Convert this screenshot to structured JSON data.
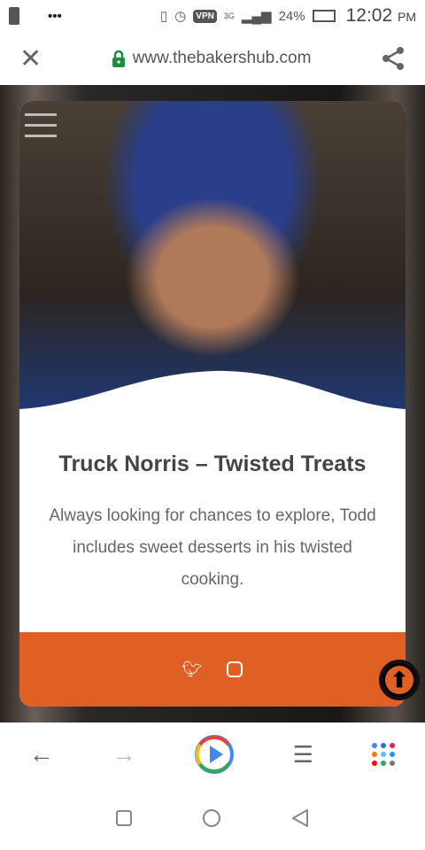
{
  "status": {
    "battery": "24%",
    "time": "12:02",
    "ampm": "PM",
    "network": "3G",
    "vpn": "VPN"
  },
  "browser": {
    "url": "www.thebakershub.com"
  },
  "card": {
    "title": "Truck Norris – Twisted Treats",
    "description": "Always looking for chances to explore, Todd includes sweet desserts in his twisted cooking."
  },
  "colors": {
    "accent": "#e06024",
    "lock": "#1e8e3e"
  }
}
